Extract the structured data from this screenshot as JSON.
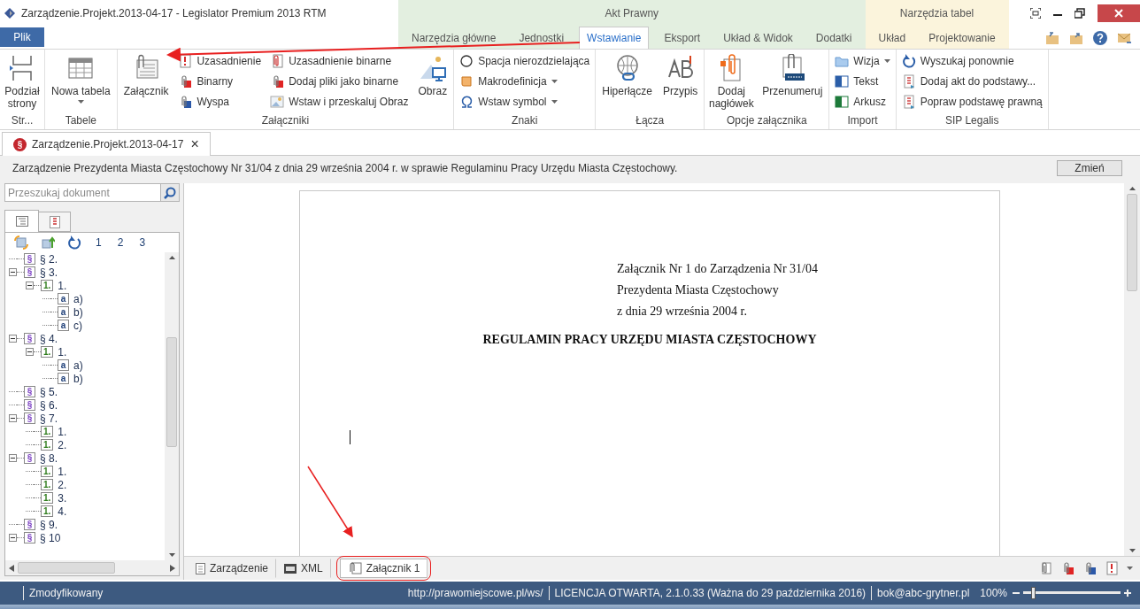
{
  "window": {
    "title": "Zarządzenie.Projekt.2013-04-17 - Legislator Premium 2013 RTM"
  },
  "file_button": "Plik",
  "tab_groups": [
    {
      "label": "Akt Prawny",
      "color": "#e3efe0",
      "tabs": [
        {
          "label": "Narzędzia główne",
          "selected": false
        },
        {
          "label": "Jednostki",
          "selected": false
        },
        {
          "label": "Wstawianie",
          "selected": true
        },
        {
          "label": "Eksport",
          "selected": false
        },
        {
          "label": "Układ & Widok",
          "selected": false
        },
        {
          "label": "Dodatki",
          "selected": false
        }
      ]
    },
    {
      "label": "Narzędzia tabel",
      "color": "#fbf4dc",
      "tabs": [
        {
          "label": "Układ",
          "selected": false
        },
        {
          "label": "Projektowanie",
          "selected": false
        }
      ]
    }
  ],
  "ribbon": [
    {
      "label": "Str...",
      "items": [
        {
          "kind": "large",
          "label": "Podział strony",
          "dropdown": false
        }
      ]
    },
    {
      "label": "Tabele",
      "items": [
        {
          "kind": "large",
          "label": "Nowa tabela",
          "dropdown": true
        }
      ]
    },
    {
      "label": "Załączniki",
      "items": [
        {
          "kind": "large",
          "label": "Załącznik",
          "dropdown": false
        },
        {
          "kind": "stack",
          "items": [
            {
              "label": "Uzasadnienie",
              "dropdown": false
            },
            {
              "label": "Binarny",
              "dropdown": false
            },
            {
              "label": "Wyspa",
              "dropdown": false
            }
          ]
        },
        {
          "kind": "stack",
          "items": [
            {
              "label": "Uzasadnienie binarne",
              "dropdown": false
            },
            {
              "label": "Dodaj pliki jako binarne",
              "dropdown": false
            },
            {
              "label": "Wstaw i przeskaluj Obraz",
              "dropdown": false
            }
          ]
        },
        {
          "kind": "large",
          "label": "Obraz",
          "dropdown": false
        }
      ]
    },
    {
      "label": "Znaki",
      "items": [
        {
          "kind": "stack",
          "items": [
            {
              "label": "Spacja nierozdzielająca",
              "dropdown": false
            },
            {
              "label": "Makrodefinicja",
              "dropdown": true
            },
            {
              "label": "Wstaw symbol",
              "dropdown": true
            }
          ]
        }
      ]
    },
    {
      "label": "Łącza",
      "items": [
        {
          "kind": "large",
          "label": "Hiperłącze",
          "dropdown": false
        },
        {
          "kind": "large",
          "label": "Przypis",
          "dropdown": false
        }
      ]
    },
    {
      "label": "Opcje załącznika",
      "items": [
        {
          "kind": "large",
          "label": "Dodaj nagłówek",
          "dropdown": false
        },
        {
          "kind": "large",
          "label": "Przenumeruj",
          "dropdown": false
        }
      ]
    },
    {
      "label": "Import",
      "items": [
        {
          "kind": "stack",
          "items": [
            {
              "label": "Wizja",
              "dropdown": true
            },
            {
              "label": "Tekst",
              "dropdown": false
            },
            {
              "label": "Arkusz",
              "dropdown": false
            }
          ]
        }
      ]
    },
    {
      "label": "SIP Legalis",
      "items": [
        {
          "kind": "stack",
          "items": [
            {
              "label": "Wyszukaj ponownie",
              "dropdown": false
            },
            {
              "label": "Dodaj akt do podstawy...",
              "dropdown": false
            },
            {
              "label": "Popraw podstawę prawną",
              "dropdown": false
            }
          ]
        }
      ]
    }
  ],
  "document_tab": {
    "badge": "§",
    "label": "Zarządzenie.Projekt.2013-04-17",
    "close": "×"
  },
  "info_bar": {
    "text": "Zarządzenie Prezydenta Miasta Częstochowy Nr 31/04  z dnia 29 września 2004 r. w sprawie Regulaminu Pracy Urzędu Miasta Częstochowy.",
    "button": "Zmień"
  },
  "search": {
    "placeholder": "Przeszukaj dokument"
  },
  "panel_tabs": [
    {
      "selected": true
    },
    {
      "selected": false
    }
  ],
  "levels": [
    "1",
    "2",
    "3"
  ],
  "tree": [
    {
      "kind": "paragraph",
      "badge": "§",
      "label": "§ 2.",
      "expanded": false
    },
    {
      "kind": "paragraph",
      "badge": "§",
      "label": "§ 3.",
      "expanded": true,
      "children": [
        {
          "kind": "point",
          "badge": "1.",
          "label": "1.",
          "expanded": true,
          "children": [
            {
              "kind": "letter",
              "badge": "a",
              "label": "a)",
              "expanded": false
            },
            {
              "kind": "letter",
              "badge": "a",
              "label": "b)",
              "expanded": false
            },
            {
              "kind": "letter",
              "badge": "a",
              "label": "c)",
              "expanded": false
            }
          ]
        }
      ]
    },
    {
      "kind": "paragraph",
      "badge": "§",
      "label": "§ 4.",
      "expanded": true,
      "children": [
        {
          "kind": "point",
          "badge": "1.",
          "label": "1.",
          "expanded": true,
          "children": [
            {
              "kind": "letter",
              "badge": "a",
              "label": "a)",
              "expanded": false
            },
            {
              "kind": "letter",
              "badge": "a",
              "label": "b)",
              "expanded": false
            }
          ]
        }
      ]
    },
    {
      "kind": "paragraph",
      "badge": "§",
      "label": "§ 5.",
      "expanded": false
    },
    {
      "kind": "paragraph",
      "badge": "§",
      "label": "§ 6.",
      "expanded": false
    },
    {
      "kind": "paragraph",
      "badge": "§",
      "label": "§ 7.",
      "expanded": true,
      "children": [
        {
          "kind": "point",
          "badge": "1.",
          "label": "1.",
          "expanded": false
        },
        {
          "kind": "point",
          "badge": "1.",
          "label": "2.",
          "expanded": false
        }
      ]
    },
    {
      "kind": "paragraph",
      "badge": "§",
      "label": "§ 8.",
      "expanded": true,
      "children": [
        {
          "kind": "point",
          "badge": "1.",
          "label": "1.",
          "expanded": false
        },
        {
          "kind": "point",
          "badge": "1.",
          "label": "2.",
          "expanded": false
        },
        {
          "kind": "point",
          "badge": "1.",
          "label": "3.",
          "expanded": false
        },
        {
          "kind": "point",
          "badge": "1.",
          "label": "4.",
          "expanded": false
        }
      ]
    },
    {
      "kind": "paragraph",
      "badge": "§",
      "label": "§ 9.",
      "expanded": false
    },
    {
      "kind": "paragraph",
      "badge": "§",
      "label": "§ 10",
      "expanded": true
    }
  ],
  "document": {
    "header_lines": [
      "Załącznik Nr 1 do Zarządzenia Nr 31/04",
      "Prezydenta Miasta Częstochowy",
      "z dnia 29 września 2004 r."
    ],
    "title": "REGULAMIN PRACY URZĘDU MIASTA CZĘSTOCHOWY"
  },
  "bottom_tabs": [
    {
      "label": "Zarządzenie",
      "selected": false
    },
    {
      "label": "XML",
      "selected": false
    },
    {
      "label": "Załącznik 1",
      "selected": true
    }
  ],
  "status_bar": {
    "state": "Zmodyfikowany",
    "url": "http://prawomiejscowe.pl/ws/",
    "license": "LICENCJA OTWARTA, 2.1.0.33 (Ważna do 29 października 2016)",
    "email": "bok@abc-grytner.pl",
    "zoom": "100%",
    "zoom_level": {
      "level": 0.1
    }
  }
}
